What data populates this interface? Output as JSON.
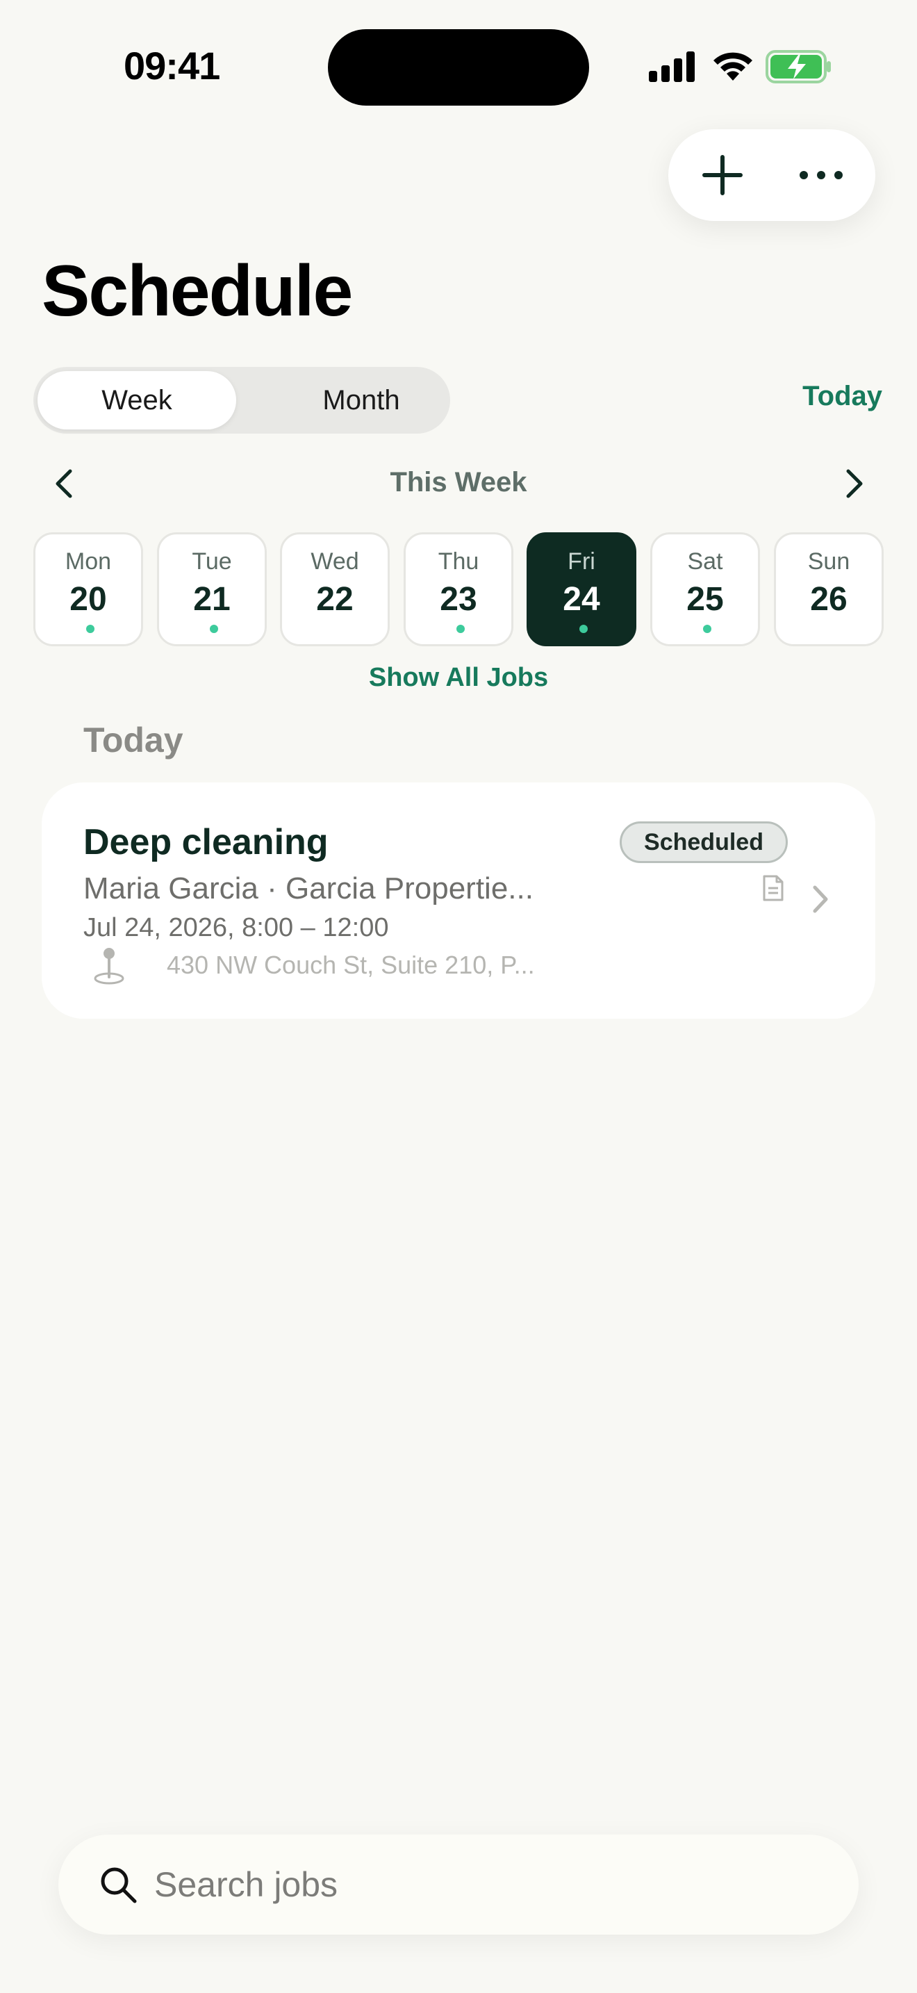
{
  "status_bar": {
    "time": "09:41"
  },
  "header": {
    "title": "Schedule",
    "add_icon": "plus-icon",
    "more_icon": "ellipsis-icon"
  },
  "view_toggle": {
    "options": [
      "Week",
      "Month"
    ],
    "selected": "Week",
    "today_label": "Today"
  },
  "week_nav": {
    "label": "This Week",
    "prev_icon": "chevron-left-icon",
    "next_icon": "chevron-right-icon"
  },
  "days": [
    {
      "name": "Mon",
      "num": "20",
      "has_jobs": true
    },
    {
      "name": "Tue",
      "num": "21",
      "has_jobs": true
    },
    {
      "name": "Wed",
      "num": "22",
      "has_jobs": false
    },
    {
      "name": "Thu",
      "num": "23",
      "has_jobs": true
    },
    {
      "name": "Fri",
      "num": "24",
      "has_jobs": true,
      "selected": true
    },
    {
      "name": "Sat",
      "num": "25",
      "has_jobs": true
    },
    {
      "name": "Sun",
      "num": "26",
      "has_jobs": false
    }
  ],
  "show_all_label": "Show All Jobs",
  "section": {
    "title": "Today"
  },
  "jobs": [
    {
      "title": "Deep cleaning",
      "status": "Scheduled",
      "client": "Maria Garcia · Garcia Propertie...",
      "time": "Jul 24, 2026, 8:00 – 12:00",
      "address": "430 NW Couch St, Suite 210, P..."
    }
  ],
  "search": {
    "placeholder": "Search jobs"
  },
  "colors": {
    "accent": "#177A5C",
    "selected_day": "#0E2B22",
    "job_dot": "#3DCB9C",
    "background": "#F8F8F4"
  }
}
